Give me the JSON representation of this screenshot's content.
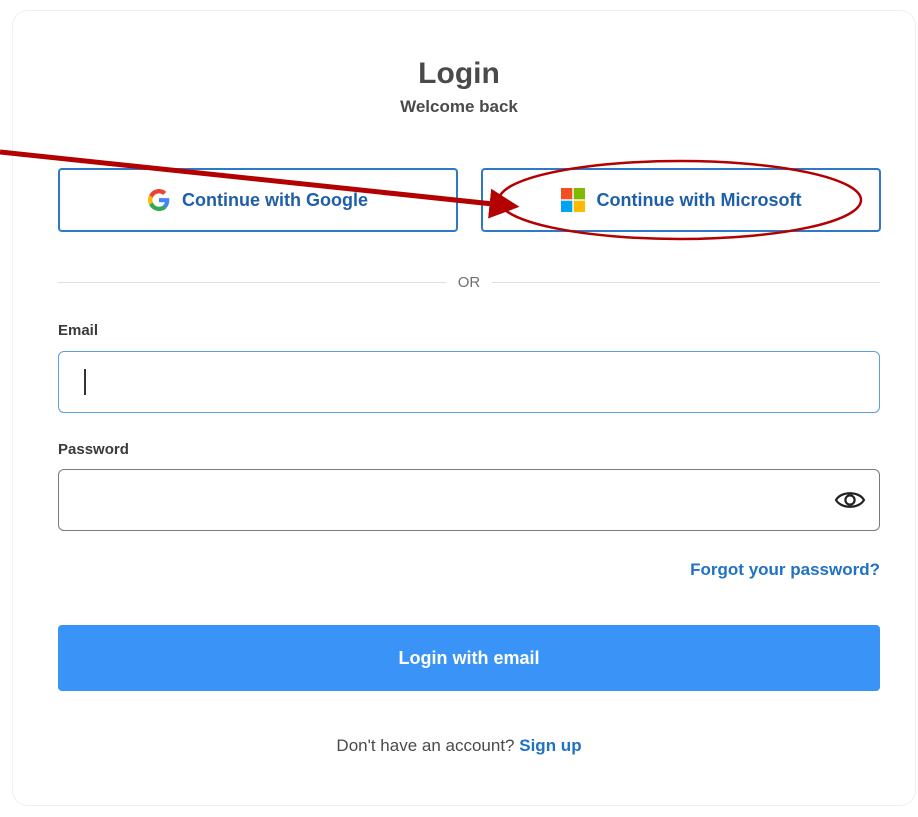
{
  "header": {
    "title": "Login",
    "subtitle": "Welcome back"
  },
  "sso": {
    "google_label": "Continue with Google",
    "microsoft_label": "Continue with Microsoft"
  },
  "divider": {
    "label": "OR"
  },
  "form": {
    "email_label": "Email",
    "email_value": "",
    "password_label": "Password",
    "password_value": "",
    "forgot_label": "Forgot your password?",
    "submit_label": "Login with email"
  },
  "footer": {
    "prompt": "Don't have an account? ",
    "signup_label": "Sign up"
  },
  "colors": {
    "primary": "#3a93f7",
    "link": "#1f72c4",
    "sso_border": "#2e79c7",
    "annotation": "#b30000"
  },
  "icons": {
    "google": "google-icon",
    "microsoft": "microsoft-icon",
    "password_toggle": "eye-icon"
  }
}
